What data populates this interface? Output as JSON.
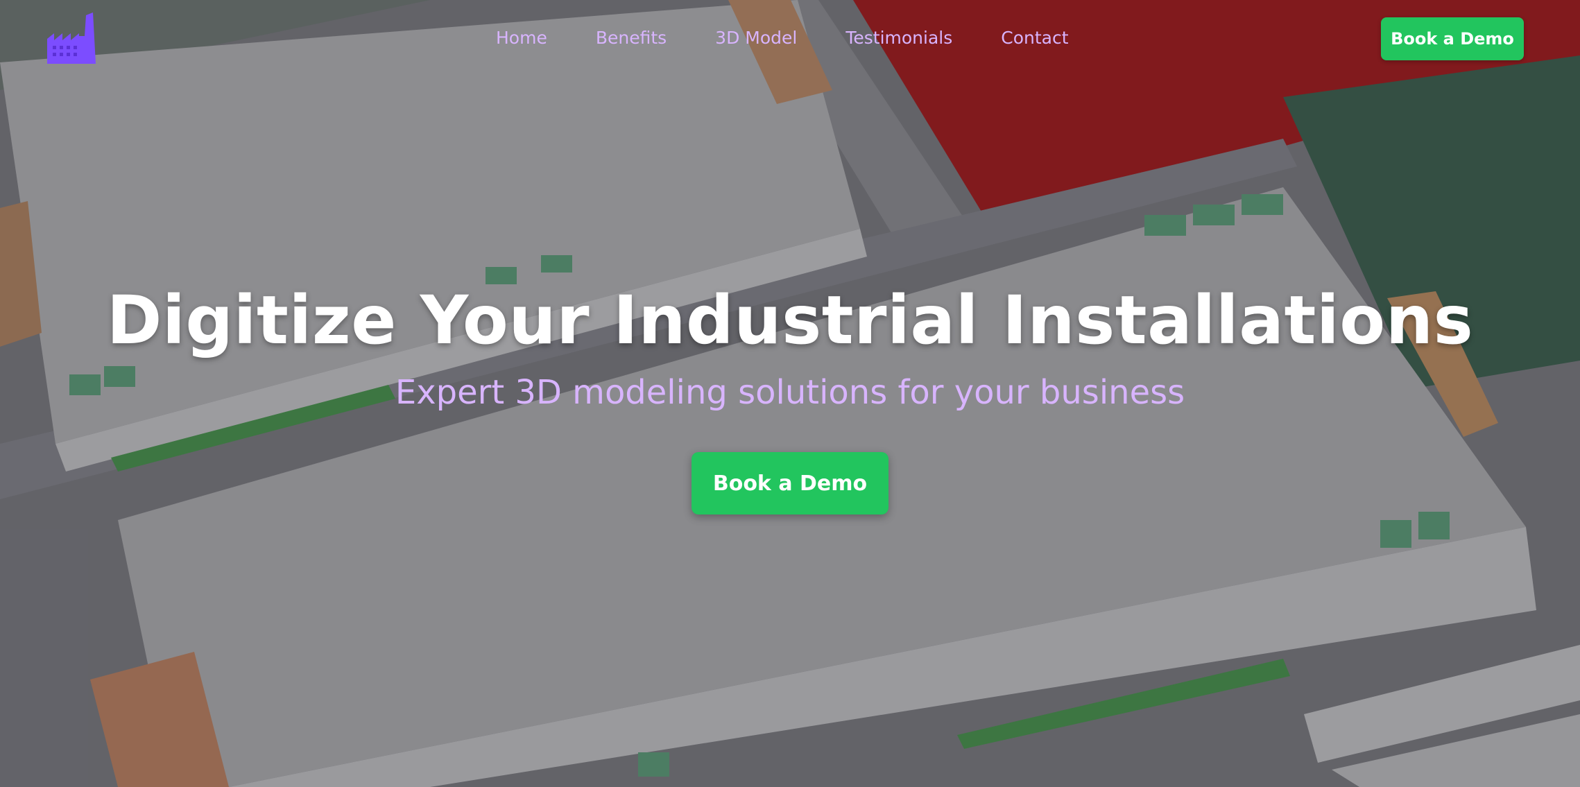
{
  "nav": {
    "logo_icon": "factory-icon",
    "links": [
      "Home",
      "Benefits",
      "3D Model",
      "Testimonials",
      "Contact"
    ],
    "cta_label": "Book a Demo"
  },
  "hero": {
    "title": "Digitize Your Industrial Installations",
    "subtitle": "Expert 3D modeling solutions for your business",
    "cta_label": "Book a Demo"
  },
  "colors": {
    "accent_green": "#22c55e",
    "nav_link_purple": "#d8b4fe",
    "logo_purple": "#7c4dff",
    "title_white": "#ffffff"
  }
}
